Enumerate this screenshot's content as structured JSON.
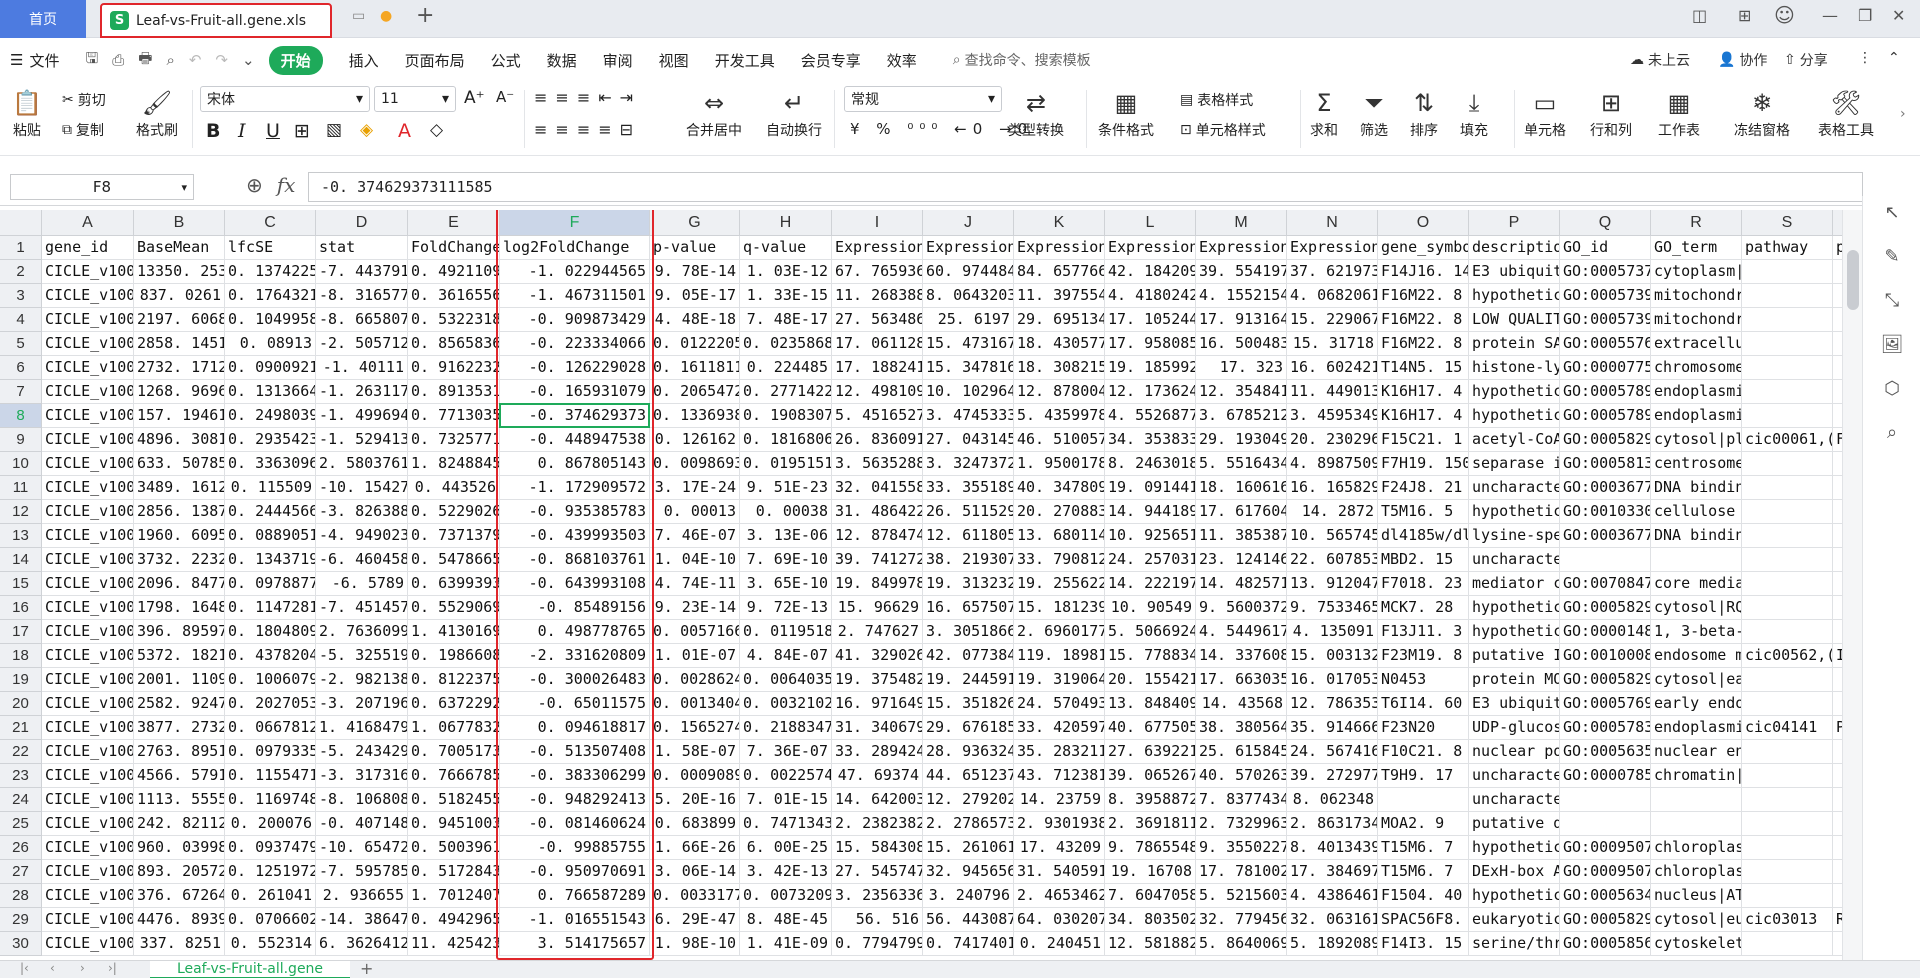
{
  "titlebar": {
    "home_tab": "首页",
    "doc_tab": "Leaf-vs-Fruit-all.gene.xls",
    "new_tab_symbol": "+"
  },
  "menubar": {
    "file": "文件",
    "tabs": [
      "开始",
      "插入",
      "页面布局",
      "公式",
      "数据",
      "审阅",
      "视图",
      "开发工具",
      "会员专享",
      "效率"
    ],
    "active_tab": "开始",
    "search_placeholder": "查找命令、搜索模板",
    "cloud": "未上云",
    "collab": "协作",
    "share": "分享"
  },
  "ribbon": {
    "paste": "粘贴",
    "cut": "剪切",
    "copy": "复制",
    "format_painter": "格式刷",
    "font_name": "宋体",
    "font_size": "11",
    "merge": "合并居中",
    "wrap": "自动换行",
    "number_format": "常规",
    "convert": "类型转换",
    "cond_format": "条件格式",
    "table_style": "表格样式",
    "cell_style": "单元格样式",
    "sum": "求和",
    "filter": "筛选",
    "sort": "排序",
    "fill": "填充",
    "cell": "单元格",
    "row_col": "行和列",
    "worksheet": "工作表",
    "freeze": "冻结窗格",
    "table_tools": "表格工具"
  },
  "formula_bar": {
    "cell_ref": "F8",
    "fx": "fx",
    "value": "-0. 374629373111585"
  },
  "grid": {
    "columns": [
      "A",
      "B",
      "C",
      "D",
      "E",
      "F",
      "G",
      "H",
      "I",
      "J",
      "K",
      "L",
      "M",
      "N",
      "O",
      "P",
      "Q",
      "R",
      "S",
      "T"
    ],
    "rows": [
      [
        "gene_id",
        "BaseMean",
        "lfcSE",
        "stat",
        "FoldChange",
        "log2FoldChange",
        "p-value",
        "q-value",
        "Expression",
        "Expression",
        "Expression",
        "Expression",
        "Expression",
        "Expression",
        "gene_symbol",
        "description",
        "GO_id",
        "GO_term",
        "pathway",
        "path"
      ],
      [
        "CICLE_v100",
        "13350. 253",
        "0. 1374225",
        "-7. 443791",
        "0. 4921109",
        "-1. 022944565",
        "9. 78E-14",
        "1. 03E-12",
        "67. 765936",
        "60. 974484",
        "84. 657766",
        "42. 184209",
        "39. 554197",
        "37. 621973",
        "F14J16. 14",
        "E3 ubiquit",
        "GO:0005737",
        "cytoplasm|cytosol|membra",
        ""
      ],
      [
        "CICLE_v100",
        "837. 0261",
        "0. 1764321",
        "-8. 316577",
        "0. 3616556",
        "-1. 467311501",
        "9. 05E-17",
        "1. 33E-15",
        "11. 268388",
        "8. 0643203",
        "11. 397554",
        "4. 4180242",
        "4. 1552154",
        "4. 0682061",
        "F16M22. 8",
        "hypothetic",
        "GO:0005739",
        "mitochondrion",
        ""
      ],
      [
        "CICLE_v100",
        "2197. 6068",
        "0. 1049958",
        "-8. 665807",
        "0. 5322318",
        "-0. 909873429",
        "4. 48E-18",
        "7. 48E-17",
        "27. 563486",
        "25. 6197",
        "29. 695134",
        "17. 105244",
        "17. 913164",
        "15. 229067",
        "F16M22. 8",
        "LOW QUALIT",
        "GO:0005739",
        "mitochondrion",
        ""
      ],
      [
        "CICLE_v100",
        "2858. 1451",
        "0. 08913",
        "-2. 505712",
        "0. 8565836",
        "-0. 223334066",
        "0. 0122205",
        "0. 0235868",
        "17. 061128",
        "15. 473167",
        "18. 430577",
        "17. 958085",
        "16. 500483",
        "15. 31718",
        "F16M22. 8",
        "protein SA",
        "GO:0005576",
        "extracellular region|Gol",
        ""
      ],
      [
        "CICLE_v100",
        "2732. 1712",
        "0. 0900921",
        "-1. 40111",
        "0. 9162232",
        "-0. 126229028",
        "0. 1611811",
        "0. 224485",
        "17. 188241",
        "15. 347816",
        "18. 308215",
        "19. 185992",
        "17. 323",
        "16. 602421",
        "T14N5. 15",
        "histone-ly",
        "GO:0000775",
        "chromosome, centromeric",
        ""
      ],
      [
        "CICLE_v100",
        "1268. 9696",
        "0. 1313664",
        "-1. 263117",
        "0. 8913531",
        "-0. 165931079",
        "0. 2065472",
        "0. 2771422",
        "12. 498109",
        "10. 102964",
        "12. 878004",
        "12. 173624",
        "12. 354841",
        "11. 449013",
        "K16H17. 4",
        "hypothetic",
        "GO:0005789",
        "endoplasmic reticulum me",
        ""
      ],
      [
        "CICLE_v100",
        "157. 19461",
        "0. 2498039",
        "-1. 499694",
        "0. 7713035",
        "-0. 374629373",
        "0. 1336938",
        "0. 1908307",
        "5. 4516527",
        "3. 4745333",
        "5. 4359978",
        "4. 5526877",
        "3. 6785212",
        "3. 4595349",
        "K16H17. 4",
        "hypothetic",
        "GO:0005789",
        "endoplasmic reticulum me",
        ""
      ],
      [
        "CICLE_v100",
        "4896. 3081",
        "0. 2935423",
        "-1. 529413",
        "0. 7325771",
        "-0. 448947538",
        "0. 126162",
        "0. 1816806",
        "26. 836091",
        "27. 043145",
        "46. 510057",
        "34. 353833",
        "29. 193049",
        "20. 230296",
        "F15C21. 1",
        "acetyl-CoA",
        "GO:0005829",
        "cytosol|pl",
        "cic00061,(",
        "Fatt"
      ],
      [
        "CICLE_v100",
        "633. 50785",
        "0. 3363096",
        "2. 5803761",
        "1. 8248845",
        "0. 867805143",
        "0. 0098693",
        "0. 0195151",
        "3. 5635288",
        "3. 3247372",
        "1. 9500178",
        "8. 2463018",
        "5. 5516434",
        "4. 8987509",
        "F7H19. 150",
        "separase i",
        "GO:0005813",
        "centrosome|cytoplasm|mic",
        ""
      ],
      [
        "CICLE_v100",
        "3489. 1612",
        "0. 115509",
        "-10. 15427",
        "0. 443526",
        "-1. 172909572",
        "3. 17E-24",
        "9. 51E-23",
        "32. 041558",
        "33. 355189",
        "40. 347809",
        "19. 091441",
        "18. 160616",
        "16. 165829",
        "F24J8. 21",
        "uncharacte",
        "GO:0003677",
        "DNA binding|metal ion bi",
        ""
      ],
      [
        "CICLE_v100",
        "2856. 1387",
        "0. 2444566",
        "-3. 826388",
        "0. 5229026",
        "-0. 935385783",
        "0. 00013",
        "0. 00038",
        "31. 486422",
        "26. 511529",
        "20. 270883",
        "14. 944189",
        "17. 617604",
        "14. 2872",
        "T5M16. 5",
        "hypothetic",
        "GO:0010330",
        "cellulose synthase compl",
        ""
      ],
      [
        "CICLE_v100",
        "1960. 6095",
        "0. 0889051",
        "-4. 949023",
        "0. 7371379",
        "-0. 439993503",
        "7. 46E-07",
        "3. 13E-06",
        "12. 878474",
        "12. 611805",
        "13. 680114",
        "10. 925651",
        "11. 385387",
        "10. 565745",
        "dl4185w/dl",
        "lysine-spe",
        "GO:0003677",
        "DNA binding|oxidoreducta",
        ""
      ],
      [
        "CICLE_v100",
        "3732. 2232",
        "0. 1343719",
        "-6. 460458",
        "0. 5478665",
        "-0. 868103761",
        "1. 04E-10",
        "7. 69E-10",
        "39. 741272",
        "38. 219307",
        "33. 790812",
        "24. 257031",
        "23. 124146",
        "22. 607853",
        "MBD2. 15",
        "uncharacterized protein LOC18040512 [Citrus",
        "",
        "",
        ""
      ],
      [
        "CICLE_v100",
        "2096. 8477",
        "0. 0978877",
        "-6. 5789",
        "0. 6399393",
        "-0. 643993108",
        "4. 74E-11",
        "3. 65E-10",
        "19. 849978",
        "19. 313232",
        "19. 255622",
        "14. 222197",
        "14. 482571",
        "13. 912047",
        "F7018. 23",
        "mediator c",
        "GO:0070847",
        "core mediator complex|me",
        ""
      ],
      [
        "CICLE_v100",
        "1798. 1648",
        "0. 1147281",
        "-7. 451457",
        "0. 5529069",
        "-0. 85489156",
        "9. 23E-14",
        "9. 72E-13",
        "15. 96629",
        "16. 657507",
        "15. 181239",
        "10. 90549",
        "9. 5600372",
        "9. 7533465",
        "MCK7. 28",
        "hypothetic",
        "GO:0005829",
        "cytosol|RQC complex|ribo",
        ""
      ],
      [
        "CICLE_v100",
        "396. 89597",
        "0. 1804809",
        "2. 7636099",
        "1. 4130169",
        "0. 498778765",
        "0. 0057166",
        "0. 0119518",
        "2. 747627",
        "3. 3051866",
        "2. 6960177",
        "5. 5066924",
        "4. 5449617",
        "4. 135091",
        "F13J11. 3",
        "hypothetic",
        "GO:0000148",
        "1, 3-beta-D-glucan syntha",
        ""
      ],
      [
        "CICLE_v100",
        "5372. 1821",
        "0. 4378204",
        "-5. 325519",
        "0. 1986608",
        "-2. 331620809",
        "1. 01E-07",
        "4. 84E-07",
        "41. 329026",
        "42. 077384",
        "119. 18981",
        "15. 778834",
        "14. 337608",
        "15. 003132",
        "F23M19. 8",
        "putative I",
        "GO:0010008",
        "endosome m",
        "cic00562,(",
        "Inos"
      ],
      [
        "CICLE_v100",
        "2001. 1109",
        "0. 1006079",
        "-2. 982138",
        "0. 8122375",
        "-0. 300026483",
        "0. 0028624",
        "0. 0064035",
        "19. 375482",
        "19. 244591",
        "19. 319064",
        "20. 155421",
        "17. 663035",
        "16. 017053",
        "N0453",
        "protein MO",
        "GO:0005829",
        "cytosol|early endosome m",
        ""
      ],
      [
        "CICLE_v100",
        "2582. 9247",
        "0. 2027053",
        "-3. 207196",
        "0. 6372292",
        "-0. 65011575",
        "0. 0013404",
        "0. 0032102",
        "16. 971649",
        "15. 351826",
        "24. 570493",
        "13. 848409",
        "14. 43568",
        "12. 786353",
        "T6I14. 60",
        "E3 ubiquit",
        "GO:0005769",
        "early endosome|trans-Gol",
        ""
      ],
      [
        "CICLE_v100",
        "3877. 2732",
        "0. 0667812",
        "1. 4168479",
        "1. 0677832",
        "0. 094618817",
        "0. 1565274",
        "0. 2188347",
        "31. 340679",
        "29. 676185",
        "33. 420597",
        "40. 677505",
        "38. 380564",
        "35. 914666",
        "F23N20",
        "UDP-glucos",
        "GO:0005783",
        "endoplasmic",
        "cic04141",
        "Prot"
      ],
      [
        "CICLE_v100",
        "2763. 8951",
        "0. 0979335",
        "-5. 243429",
        "0. 7005173",
        "-0. 513507408",
        "1. 58E-07",
        "7. 36E-07",
        "33. 289424",
        "28. 936324",
        "35. 283211",
        "27. 639221",
        "25. 615845",
        "24. 567416",
        "F10C21. 8",
        "nuclear po",
        "GO:0005635",
        "nuclear envelope|nuclear",
        ""
      ],
      [
        "CICLE_v100",
        "4566. 5791",
        "0. 1155471",
        "-3. 317316",
        "0. 7666785",
        "-0. 383306299",
        "0. 0009089",
        "0. 0022574",
        "47. 69374",
        "44. 651237",
        "43. 712381",
        "39. 065267",
        "40. 570263",
        "39. 272977",
        "T9H9. 17",
        "uncharacte",
        "GO:0000785",
        "chromatin|cytoplasm|nucl",
        ""
      ],
      [
        "CICLE_v100",
        "1113. 5555",
        "0. 1169748",
        "-8. 106808",
        "0. 5182455",
        "-0. 948292413",
        "5. 20E-16",
        "7. 01E-15",
        "14. 642003",
        "12. 279202",
        "14. 23759",
        "8. 3958872",
        "7. 8377434",
        "8. 062348",
        "",
        "uncharacterized protein LOC18041967 [Citrus",
        "",
        "",
        ""
      ],
      [
        "CICLE_v100",
        "242. 82112",
        "0. 200076",
        "-0. 407148",
        "0. 9451003",
        "-0. 081460624",
        "0. 683899",
        "0. 7471343",
        "2. 2382382",
        "2. 2786573",
        "2. 9301938",
        "2. 3691811",
        "2. 7329963",
        "2. 8631734",
        "MOA2. 9",
        "putative disease resistance RPP13-like prote",
        "",
        "",
        ""
      ],
      [
        "CICLE_v100",
        "960. 03998",
        "0. 0937479",
        "-10. 65472",
        "0. 5003961",
        "-0. 99885755",
        "1. 66E-26",
        "6. 00E-25",
        "15. 584308",
        "15. 261061",
        "17. 43209",
        "9. 7865548",
        "9. 3550227",
        "8. 4013439",
        "T15M6. 7",
        "hypothetic",
        "GO:0009507",
        "chloroplast|ATP binding|",
        ""
      ],
      [
        "CICLE_v100",
        "893. 20572",
        "0. 1251972",
        "-7. 595785",
        "0. 5172843",
        "-0. 950970691",
        "3. 06E-14",
        "3. 42E-13",
        "27. 545747",
        "32. 945656",
        "31. 540591",
        "19. 16708",
        "17. 781002",
        "17. 384697",
        "T15M6. 7",
        "DExH-box A",
        "GO:0009507",
        "chloroplast|ATP binding|",
        ""
      ],
      [
        "CICLE_v100",
        "376. 67264",
        "0. 261041",
        "2. 936655",
        "1. 7012407",
        "0. 766587289",
        "0. 0033177",
        "0. 0073209",
        "3. 2356336",
        "3. 240796",
        "2. 4653462",
        "7. 6047058",
        "5. 5215603",
        "4. 4386461",
        "F1504. 40",
        "hypothetic",
        "GO:0005634",
        "nucleus|ATP binding|DNA",
        ""
      ],
      [
        "CICLE_v100",
        "4476. 8939",
        "0. 0706602",
        "-14. 38647",
        "0. 4942965",
        "-1. 016551543",
        "6. 29E-47",
        "8. 48E-45",
        "56. 516",
        "56. 443087",
        "64. 030207",
        "34. 803502",
        "32. 779456",
        "32. 063161",
        "SPAC56F8. 0",
        "eukaryotic",
        "GO:0005829",
        "cytosol|eu",
        "cic03013",
        "RNA"
      ],
      [
        "CICLE_v100",
        "337. 8251",
        "0. 552314",
        "6. 3626412",
        "11. 425423",
        "3. 514175657",
        "1. 98E-10",
        "1. 41E-09",
        "0. 7794799",
        "0. 7417401",
        "0. 240451",
        "12. 581882",
        "5. 8640069",
        "5. 1892089",
        "F14I3. 15",
        "serine/thr",
        "GO:0005856",
        "cytoskeleton|phragmoplas",
        ""
      ]
    ],
    "active_cell": "F8"
  },
  "sheets": {
    "active": "Leaf-vs-Fruit-all.gene"
  },
  "colors": {
    "accent_green": "#1eaa5a",
    "highlight_red": "#e0262b",
    "home_tab_blue": "#4d7be0"
  }
}
